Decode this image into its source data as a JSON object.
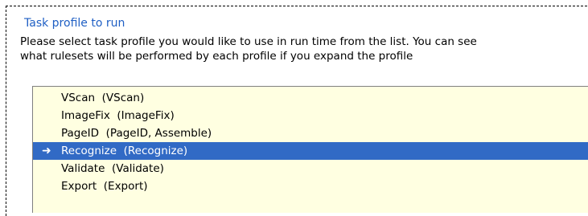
{
  "group": {
    "title": "Task profile to run",
    "description_line1": "Please select task profile you would like to use in run time from the list. You can see",
    "description_line2": "what rulesets will be performed by each profile if you expand the profile"
  },
  "profiles": {
    "selected_index": 3,
    "selected_marker": "arrow-right-icon",
    "items": [
      {
        "label": "VScan  (VScan)"
      },
      {
        "label": "ImageFix  (ImageFix)"
      },
      {
        "label": "PageID  (PageID, Assemble)"
      },
      {
        "label": "Recognize  (Recognize)"
      },
      {
        "label": "Validate  (Validate)"
      },
      {
        "label": "Export  (Export)"
      }
    ]
  },
  "colors": {
    "title": "#1f5fc4",
    "list_background": "#ffffe1",
    "selection": "#316ac5"
  }
}
